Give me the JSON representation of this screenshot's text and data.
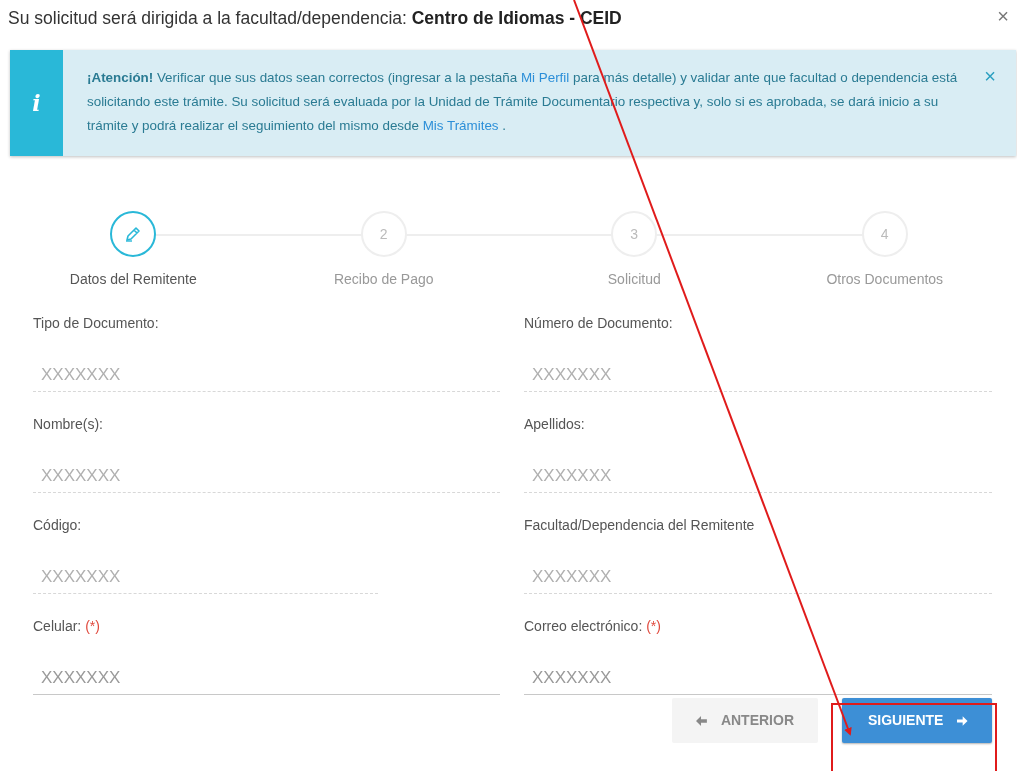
{
  "modal": {
    "title": "Su solicitud será dirigida a la facultad/dependencia: **Centro de Idiomas - CEID**",
    "close": "×"
  },
  "alert": {
    "icon": "i",
    "close": "×",
    "segments": [
      {
        "kind": "text",
        "text": "**¡Atención!** Verificar que sus datos sean correctos (ingresar a la pestaña "
      },
      {
        "kind": "link",
        "text": "Mi Perfil"
      },
      {
        "kind": "text",
        "text": " para más detalle) y validar ante que facultad o dependencia está solicitando este trámite. Su solicitud será evaluada por la Unidad de Trámite Documentario respectiva y, solo si es aprobada, se dará inicio a su trámite y podrá realizar el seguimiento del mismo desde "
      },
      {
        "kind": "link",
        "text": "Mis Trámites"
      },
      {
        "kind": "text",
        "text": " ."
      }
    ]
  },
  "steps": [
    {
      "label": "Datos del Remitente",
      "selected": true
    },
    {
      "label": "Recibo de Pago",
      "number": "2",
      "selected": false
    },
    {
      "label": "Solicitud",
      "number": "3",
      "selected": false
    },
    {
      "label": "Otros Documentos",
      "number": "4",
      "selected": false
    }
  ],
  "fields": [
    {
      "label": "Tipo de Documento:",
      "value": "XXXXXXX",
      "disabled": true
    },
    {
      "label": "Número de Documento:",
      "value": "XXXXXXX",
      "disabled": true
    },
    {
      "label": "Nombre(s):",
      "value": "XXXXXXX",
      "disabled": true
    },
    {
      "label": "Apellidos:",
      "value": "XXXXXXX",
      "disabled": true
    },
    {
      "label": "Código:",
      "value": "XXXXXXX",
      "disabled": true
    },
    {
      "label": "Facultad/Dependencia del Remitente",
      "value": "XXXXXXX",
      "disabled": true
    },
    {
      "label": "Celular:",
      "required": "(*)",
      "value": "XXXXXXX",
      "disabled": false
    },
    {
      "label": "Correo electrónico:",
      "required": "(*)",
      "value": "XXXXXXX",
      "disabled": false
    }
  ],
  "buttons": [
    {
      "kind": "back",
      "label": "ANTERIOR"
    },
    {
      "kind": "next",
      "label": "SIGUIENTE"
    }
  ]
}
